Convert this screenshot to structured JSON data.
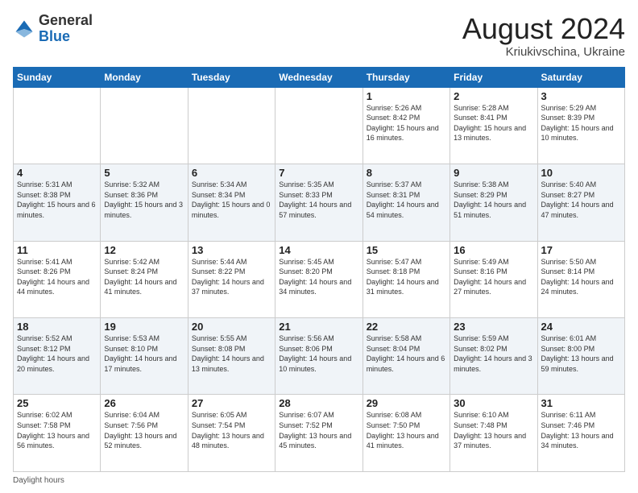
{
  "header": {
    "logo_general": "General",
    "logo_blue": "Blue",
    "month_year": "August 2024",
    "location": "Kriukivschina, Ukraine"
  },
  "days_of_week": [
    "Sunday",
    "Monday",
    "Tuesday",
    "Wednesday",
    "Thursday",
    "Friday",
    "Saturday"
  ],
  "footer": {
    "daylight_hours": "Daylight hours"
  },
  "weeks": [
    [
      {
        "day": "",
        "sunrise": "",
        "sunset": "",
        "daylight": ""
      },
      {
        "day": "",
        "sunrise": "",
        "sunset": "",
        "daylight": ""
      },
      {
        "day": "",
        "sunrise": "",
        "sunset": "",
        "daylight": ""
      },
      {
        "day": "",
        "sunrise": "",
        "sunset": "",
        "daylight": ""
      },
      {
        "day": "1",
        "sunrise": "5:26 AM",
        "sunset": "8:42 PM",
        "daylight": "15 hours and 16 minutes."
      },
      {
        "day": "2",
        "sunrise": "5:28 AM",
        "sunset": "8:41 PM",
        "daylight": "15 hours and 13 minutes."
      },
      {
        "day": "3",
        "sunrise": "5:29 AM",
        "sunset": "8:39 PM",
        "daylight": "15 hours and 10 minutes."
      }
    ],
    [
      {
        "day": "4",
        "sunrise": "5:31 AM",
        "sunset": "8:38 PM",
        "daylight": "15 hours and 6 minutes."
      },
      {
        "day": "5",
        "sunrise": "5:32 AM",
        "sunset": "8:36 PM",
        "daylight": "15 hours and 3 minutes."
      },
      {
        "day": "6",
        "sunrise": "5:34 AM",
        "sunset": "8:34 PM",
        "daylight": "15 hours and 0 minutes."
      },
      {
        "day": "7",
        "sunrise": "5:35 AM",
        "sunset": "8:33 PM",
        "daylight": "14 hours and 57 minutes."
      },
      {
        "day": "8",
        "sunrise": "5:37 AM",
        "sunset": "8:31 PM",
        "daylight": "14 hours and 54 minutes."
      },
      {
        "day": "9",
        "sunrise": "5:38 AM",
        "sunset": "8:29 PM",
        "daylight": "14 hours and 51 minutes."
      },
      {
        "day": "10",
        "sunrise": "5:40 AM",
        "sunset": "8:27 PM",
        "daylight": "14 hours and 47 minutes."
      }
    ],
    [
      {
        "day": "11",
        "sunrise": "5:41 AM",
        "sunset": "8:26 PM",
        "daylight": "14 hours and 44 minutes."
      },
      {
        "day": "12",
        "sunrise": "5:42 AM",
        "sunset": "8:24 PM",
        "daylight": "14 hours and 41 minutes."
      },
      {
        "day": "13",
        "sunrise": "5:44 AM",
        "sunset": "8:22 PM",
        "daylight": "14 hours and 37 minutes."
      },
      {
        "day": "14",
        "sunrise": "5:45 AM",
        "sunset": "8:20 PM",
        "daylight": "14 hours and 34 minutes."
      },
      {
        "day": "15",
        "sunrise": "5:47 AM",
        "sunset": "8:18 PM",
        "daylight": "14 hours and 31 minutes."
      },
      {
        "day": "16",
        "sunrise": "5:49 AM",
        "sunset": "8:16 PM",
        "daylight": "14 hours and 27 minutes."
      },
      {
        "day": "17",
        "sunrise": "5:50 AM",
        "sunset": "8:14 PM",
        "daylight": "14 hours and 24 minutes."
      }
    ],
    [
      {
        "day": "18",
        "sunrise": "5:52 AM",
        "sunset": "8:12 PM",
        "daylight": "14 hours and 20 minutes."
      },
      {
        "day": "19",
        "sunrise": "5:53 AM",
        "sunset": "8:10 PM",
        "daylight": "14 hours and 17 minutes."
      },
      {
        "day": "20",
        "sunrise": "5:55 AM",
        "sunset": "8:08 PM",
        "daylight": "14 hours and 13 minutes."
      },
      {
        "day": "21",
        "sunrise": "5:56 AM",
        "sunset": "8:06 PM",
        "daylight": "14 hours and 10 minutes."
      },
      {
        "day": "22",
        "sunrise": "5:58 AM",
        "sunset": "8:04 PM",
        "daylight": "14 hours and 6 minutes."
      },
      {
        "day": "23",
        "sunrise": "5:59 AM",
        "sunset": "8:02 PM",
        "daylight": "14 hours and 3 minutes."
      },
      {
        "day": "24",
        "sunrise": "6:01 AM",
        "sunset": "8:00 PM",
        "daylight": "13 hours and 59 minutes."
      }
    ],
    [
      {
        "day": "25",
        "sunrise": "6:02 AM",
        "sunset": "7:58 PM",
        "daylight": "13 hours and 56 minutes."
      },
      {
        "day": "26",
        "sunrise": "6:04 AM",
        "sunset": "7:56 PM",
        "daylight": "13 hours and 52 minutes."
      },
      {
        "day": "27",
        "sunrise": "6:05 AM",
        "sunset": "7:54 PM",
        "daylight": "13 hours and 48 minutes."
      },
      {
        "day": "28",
        "sunrise": "6:07 AM",
        "sunset": "7:52 PM",
        "daylight": "13 hours and 45 minutes."
      },
      {
        "day": "29",
        "sunrise": "6:08 AM",
        "sunset": "7:50 PM",
        "daylight": "13 hours and 41 minutes."
      },
      {
        "day": "30",
        "sunrise": "6:10 AM",
        "sunset": "7:48 PM",
        "daylight": "13 hours and 37 minutes."
      },
      {
        "day": "31",
        "sunrise": "6:11 AM",
        "sunset": "7:46 PM",
        "daylight": "13 hours and 34 minutes."
      }
    ]
  ]
}
